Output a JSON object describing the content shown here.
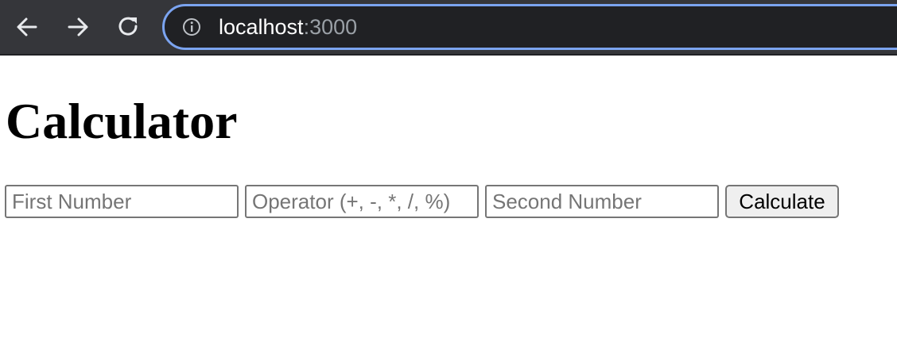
{
  "browser": {
    "url_host": "localhost",
    "url_port": ":3000",
    "icons": {
      "back": "arrow-left-icon",
      "forward": "arrow-right-icon",
      "reload": "reload-icon",
      "info": "info-icon"
    }
  },
  "page": {
    "title": "Calculator",
    "inputs": {
      "first": {
        "placeholder": "First Number",
        "value": ""
      },
      "operator": {
        "placeholder": "Operator (+, -, *, /, %)",
        "value": ""
      },
      "second": {
        "placeholder": "Second Number",
        "value": ""
      }
    },
    "calculate_label": "Calculate"
  },
  "colors": {
    "toolbar_bg": "#35363a",
    "omnibox_bg": "#202124",
    "omnibox_focus_ring": "#7ba4f0"
  }
}
